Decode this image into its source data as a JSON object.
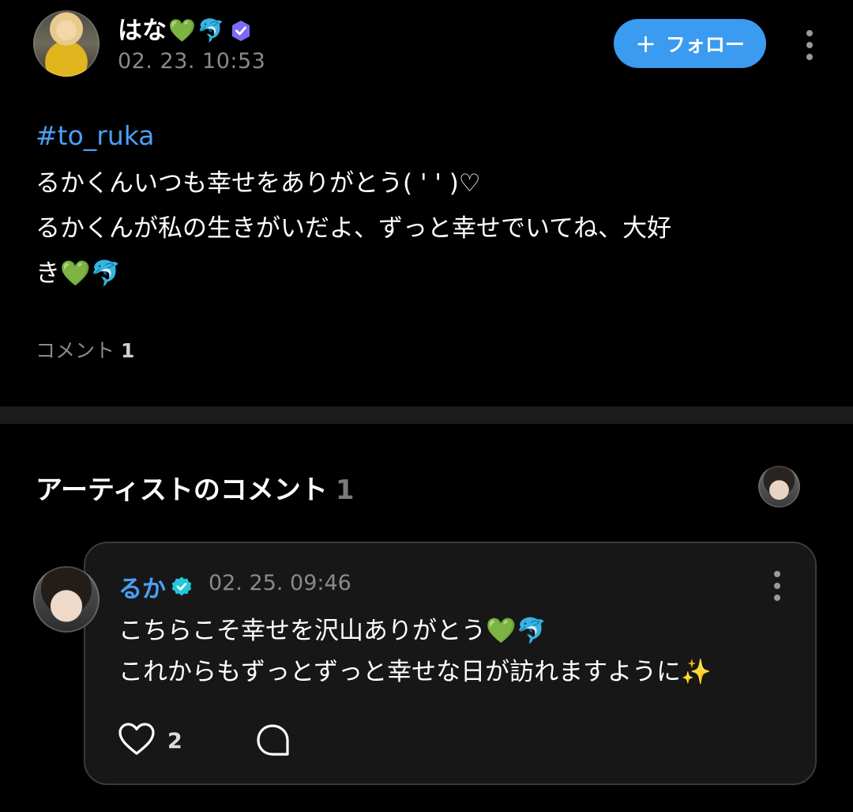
{
  "post": {
    "author": {
      "name": "はな",
      "emojis": [
        "💚",
        "🐬"
      ]
    },
    "timestamp": "02. 23. 10:53",
    "follow_label": "フォロー",
    "hashtag": "#to_ruka",
    "text": "るかくんいつも幸せをありがとう( ' ' )♡\nるかくんが私の生きがいだよ、ずっと幸せでいてね、大好\nき💚🐬",
    "comment_label": "コメント",
    "comment_count": "1"
  },
  "artist_comments": {
    "heading": "アーティストのコメント",
    "count": "1",
    "comment": {
      "author": "るか",
      "timestamp": "02. 25. 09:46",
      "text": "こちらこそ幸せを沢山ありがとう💚🐬\nこれからもずっとずっと幸せな日が訪れますように✨",
      "like_count": "2"
    }
  },
  "colors": {
    "background": "#000000",
    "accent": "#3a9bf0",
    "link": "#4a9ff5",
    "verified_badge": "#26c6da",
    "card": "#171717"
  },
  "icons": [
    "plus-icon",
    "verified-badge-icon",
    "more-vertical-icon",
    "heart-icon",
    "comment-bubble-icon",
    "check-badge-icon"
  ]
}
